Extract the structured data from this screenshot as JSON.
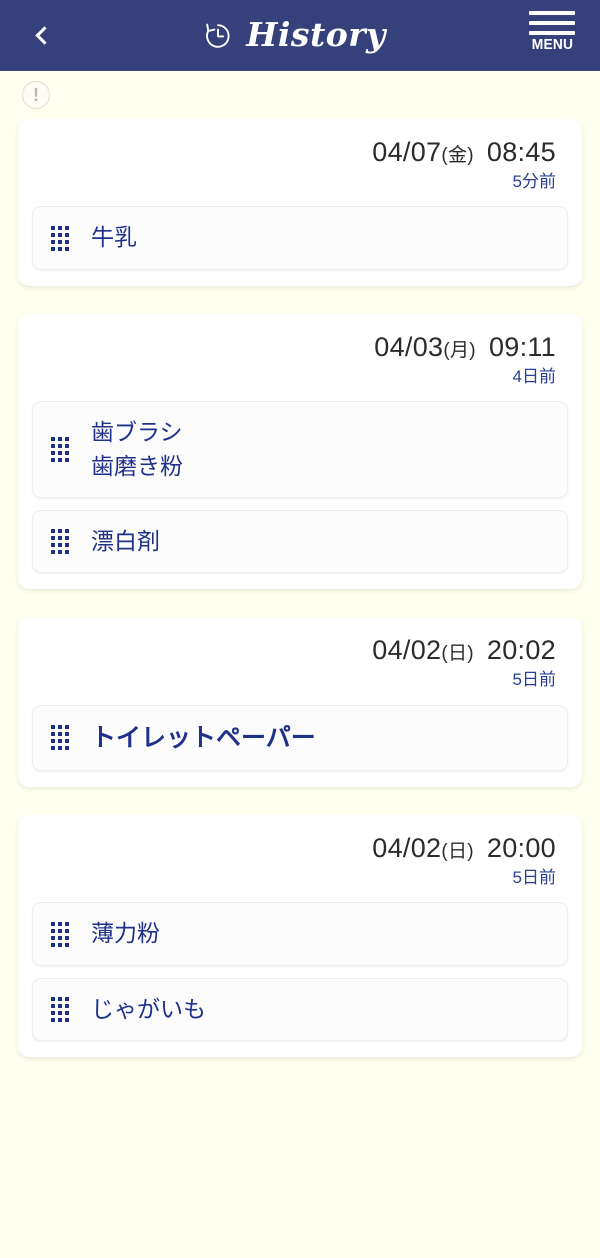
{
  "header": {
    "back_label": "‹",
    "title": "History",
    "title_icon": "history-clock-icon",
    "menu_label": "MENU",
    "menu_icon": "hamburger-icon",
    "background_color": "#36407a"
  },
  "notice": {
    "icon": "exclamation-circle-icon",
    "glyph": "!"
  },
  "theme": {
    "page_background": "#fffff0",
    "item_text_color": "#1f3189",
    "relative_time_color": "#2a3f94",
    "date_color": "#2b2b2b"
  },
  "cards": [
    {
      "date": "04/07",
      "dow": "(金)",
      "time": "08:45",
      "relative": "5分前",
      "items": [
        {
          "text": "牛乳",
          "emphasis": false
        }
      ]
    },
    {
      "date": "04/03",
      "dow": "(月)",
      "time": "09:11",
      "relative": "4日前",
      "items": [
        {
          "text": "歯ブラシ\n歯磨き粉",
          "emphasis": false
        },
        {
          "text": "漂白剤",
          "emphasis": false
        }
      ]
    },
    {
      "date": "04/02",
      "dow": "(日)",
      "time": "20:02",
      "relative": "5日前",
      "items": [
        {
          "text": "トイレットペーパー",
          "emphasis": true
        }
      ]
    },
    {
      "date": "04/02",
      "dow": "(日)",
      "time": "20:00",
      "relative": "5日前",
      "items": [
        {
          "text": "薄力粉",
          "emphasis": false
        },
        {
          "text": "じゃがいも",
          "emphasis": false
        }
      ]
    }
  ]
}
